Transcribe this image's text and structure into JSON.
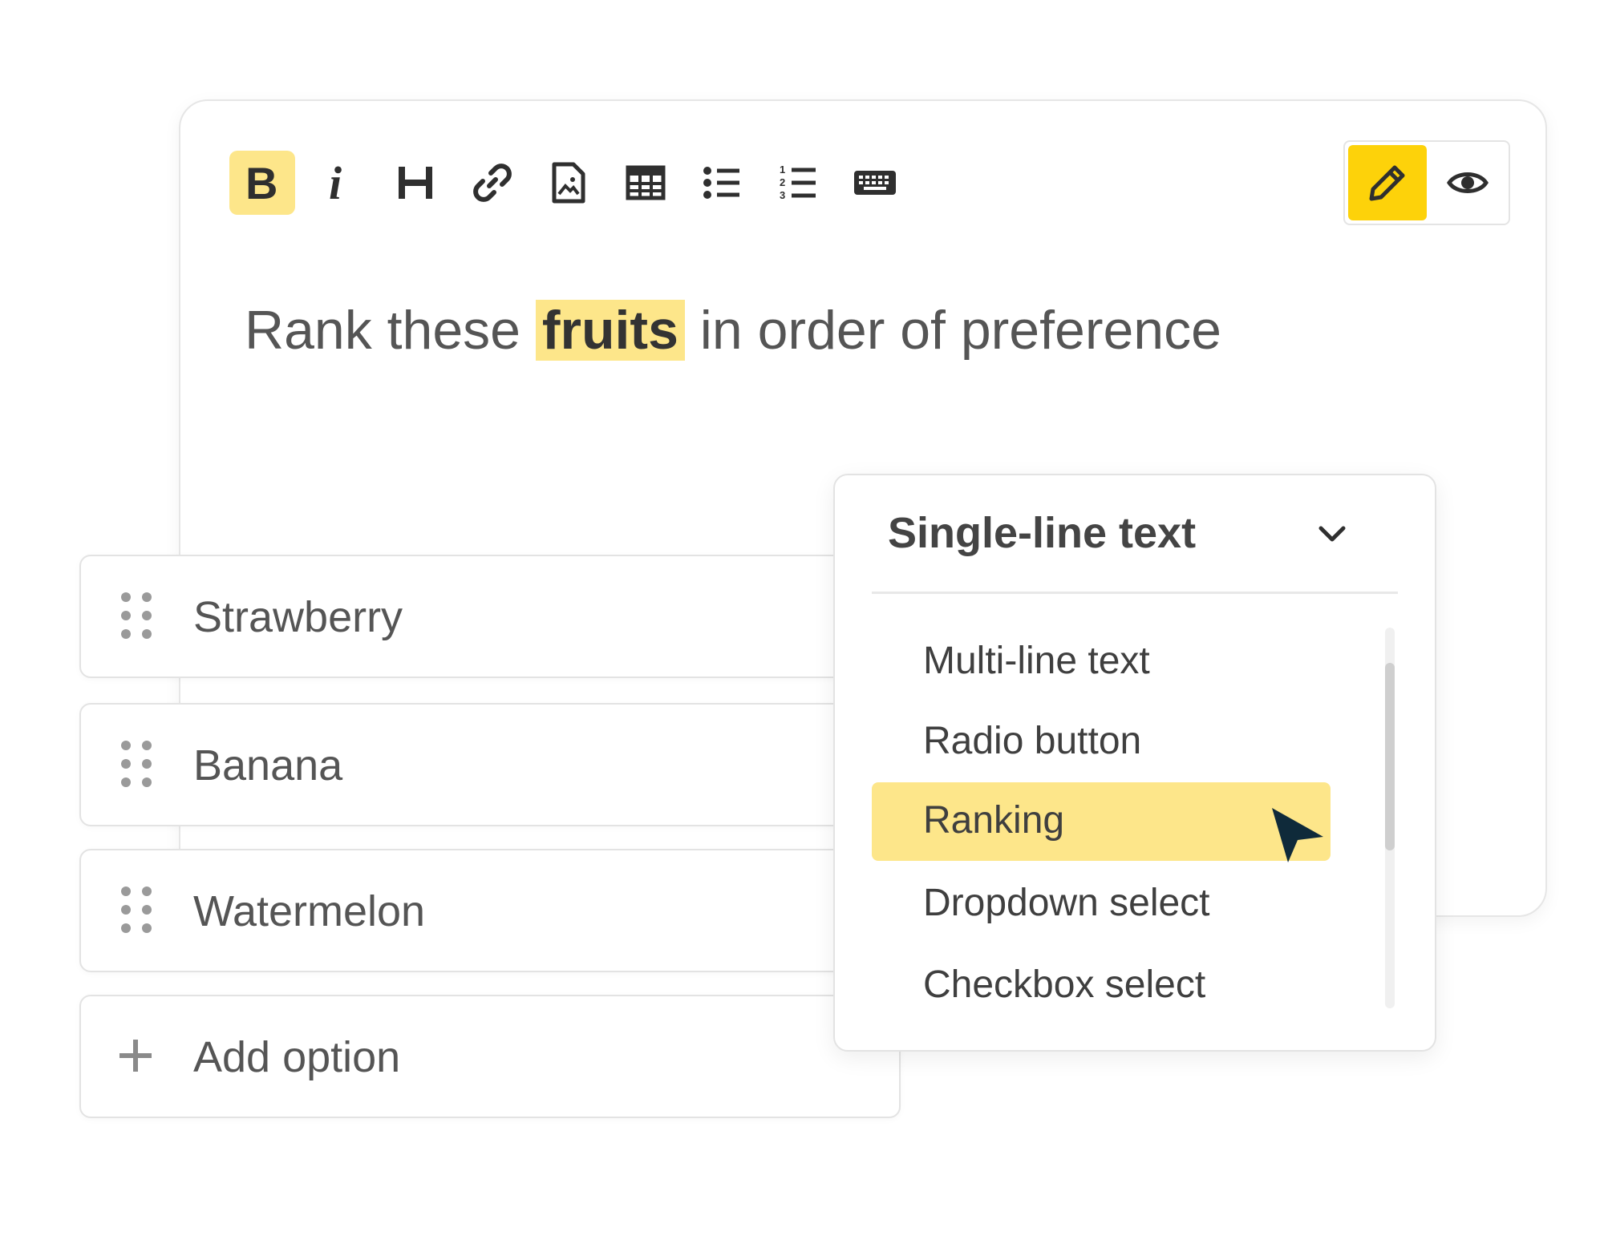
{
  "colors": {
    "accent_yellow": "#fdd20a",
    "highlight_yellow": "#fde68a",
    "text_gray": "#555555",
    "cursor_navy": "#0f2a3a"
  },
  "toolbar": {
    "buttons": [
      {
        "name": "bold",
        "icon": "bold-icon",
        "active": true
      },
      {
        "name": "italic",
        "icon": "italic-icon",
        "active": false
      },
      {
        "name": "heading",
        "icon": "heading-icon",
        "active": false
      },
      {
        "name": "link",
        "icon": "link-icon",
        "active": false
      },
      {
        "name": "image",
        "icon": "image-file-icon",
        "active": false
      },
      {
        "name": "table",
        "icon": "table-icon",
        "active": false
      },
      {
        "name": "bulleted-list",
        "icon": "bulleted-list-icon",
        "active": false
      },
      {
        "name": "numbered-list",
        "icon": "numbered-list-icon",
        "active": false
      },
      {
        "name": "keyboard",
        "icon": "keyboard-icon",
        "active": false
      }
    ],
    "mode_toggle": {
      "edit_icon": "pencil-icon",
      "preview_icon": "eye-icon",
      "active": "edit"
    }
  },
  "question": {
    "before": "Rank these ",
    "highlight": "fruits",
    "after": " in order of preference"
  },
  "options": [
    {
      "label": "Strawberry"
    },
    {
      "label": "Banana"
    },
    {
      "label": "Watermelon"
    }
  ],
  "add_option": {
    "label": "Add option"
  },
  "type_dropdown": {
    "selected": "Single-line text",
    "options": [
      {
        "label": "Multi-line text"
      },
      {
        "label": "Radio button"
      },
      {
        "label": "Ranking",
        "highlighted": true
      },
      {
        "label": "Dropdown select"
      },
      {
        "label": "Checkbox select"
      }
    ]
  }
}
